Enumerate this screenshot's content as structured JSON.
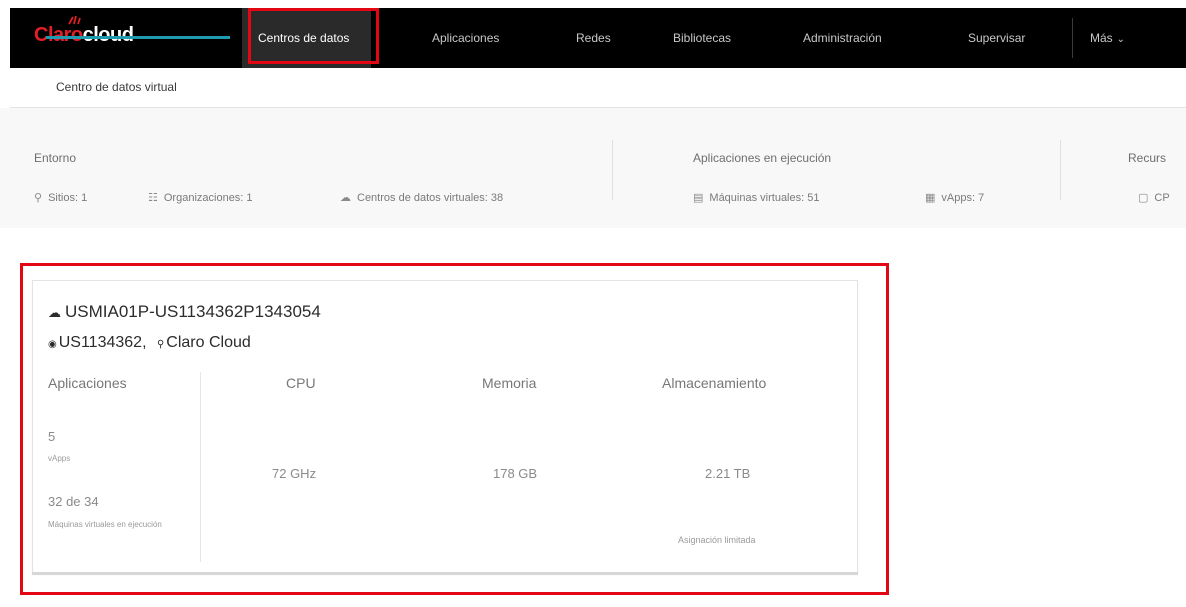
{
  "header": {
    "logo_brand": "Claro",
    "logo_product": "cloud",
    "nav": [
      {
        "label": "Centros de datos",
        "active": true
      },
      {
        "label": "Aplicaciones",
        "active": false
      },
      {
        "label": "Redes",
        "active": false
      },
      {
        "label": "Bibliotecas",
        "active": false
      },
      {
        "label": "Administración",
        "active": false
      },
      {
        "label": "Supervisar",
        "active": false
      },
      {
        "label": "Más",
        "active": false
      }
    ]
  },
  "subnav": {
    "tab": "Centro de datos virtual"
  },
  "summary": {
    "entorno": {
      "title": "Entorno",
      "sitios": "Sitios: 1",
      "organizaciones": "Organizaciones: 1",
      "centros": "Centros de datos virtuales: 38"
    },
    "aplicaciones": {
      "title": "Aplicaciones en ejecución",
      "maquinas": "Máquinas virtuales: 51",
      "vapps": "vApps: 7"
    },
    "recursos": {
      "title": "Recurs",
      "cpu": "CP"
    }
  },
  "card": {
    "title": "USMIA01P-US1134362P1343054",
    "org_id": "US1134362,",
    "site": "Claro Cloud",
    "apps_label": "Aplicaciones",
    "vapps_count": "5",
    "vapps_label": "vApps",
    "vm_count": "32 de 34",
    "vm_label": "Máquinas virtuales en ejecución",
    "cpu_label": "CPU",
    "cpu_value": "72 GHz",
    "mem_label": "Memoria",
    "mem_value": "178 GB",
    "storage_label": "Almacenamiento",
    "storage_value": "2.21 TB",
    "storage_note": "Asignación limitada"
  },
  "colors": {
    "accent_red": "#e30613",
    "brand_red": "#e11f26",
    "tab_underline": "#1f9bb0",
    "topbar_bg": "#000000"
  }
}
